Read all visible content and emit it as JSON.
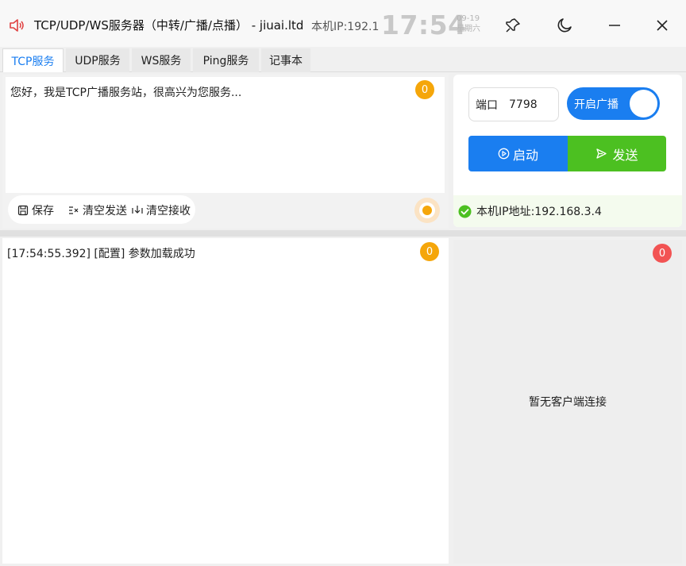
{
  "window": {
    "title": "TCP/UDP/WS服务器（中转/广播/点播） - jiuai.ltd",
    "local_ip_label": "本机IP:192.1",
    "clock": "17:54",
    "date": "09-19",
    "weekday": "星期六"
  },
  "tabs": [
    {
      "label": "TCP服务",
      "active": true
    },
    {
      "label": "UDP服务",
      "active": false
    },
    {
      "label": "WS服务",
      "active": false
    },
    {
      "label": "Ping服务",
      "active": false
    },
    {
      "label": "记事本",
      "active": false
    }
  ],
  "send": {
    "text": "您好，我是TCP广播服务站，很高兴为您服务...",
    "count": "0",
    "save_label": "保存",
    "clear_send_label": "清空发送",
    "clear_recv_label": "清空接收"
  },
  "control": {
    "port_label": "端口",
    "port_value": "7798",
    "broadcast_label": "开启广播",
    "broadcast_on": true,
    "start_label": "启动",
    "send_label": "发送",
    "ip_status": "本机IP地址:192.168.3.4"
  },
  "log": {
    "count": "0",
    "lines": [
      "[17:54:55.392] [配置] 参数加载成功"
    ]
  },
  "clients": {
    "count": "0",
    "empty_text": "暂无客户端连接"
  },
  "colors": {
    "primary": "#1a7ef0",
    "success": "#4cc021",
    "badge_orange": "#f5a60a",
    "badge_red": "#f25353"
  },
  "icons": [
    "speaker-icon",
    "pin-icon",
    "moon-icon",
    "minimize-icon",
    "close-icon",
    "save-icon",
    "clear-send-icon",
    "clear-recv-icon",
    "play-circle-icon",
    "send-icon",
    "check-circle-icon"
  ]
}
